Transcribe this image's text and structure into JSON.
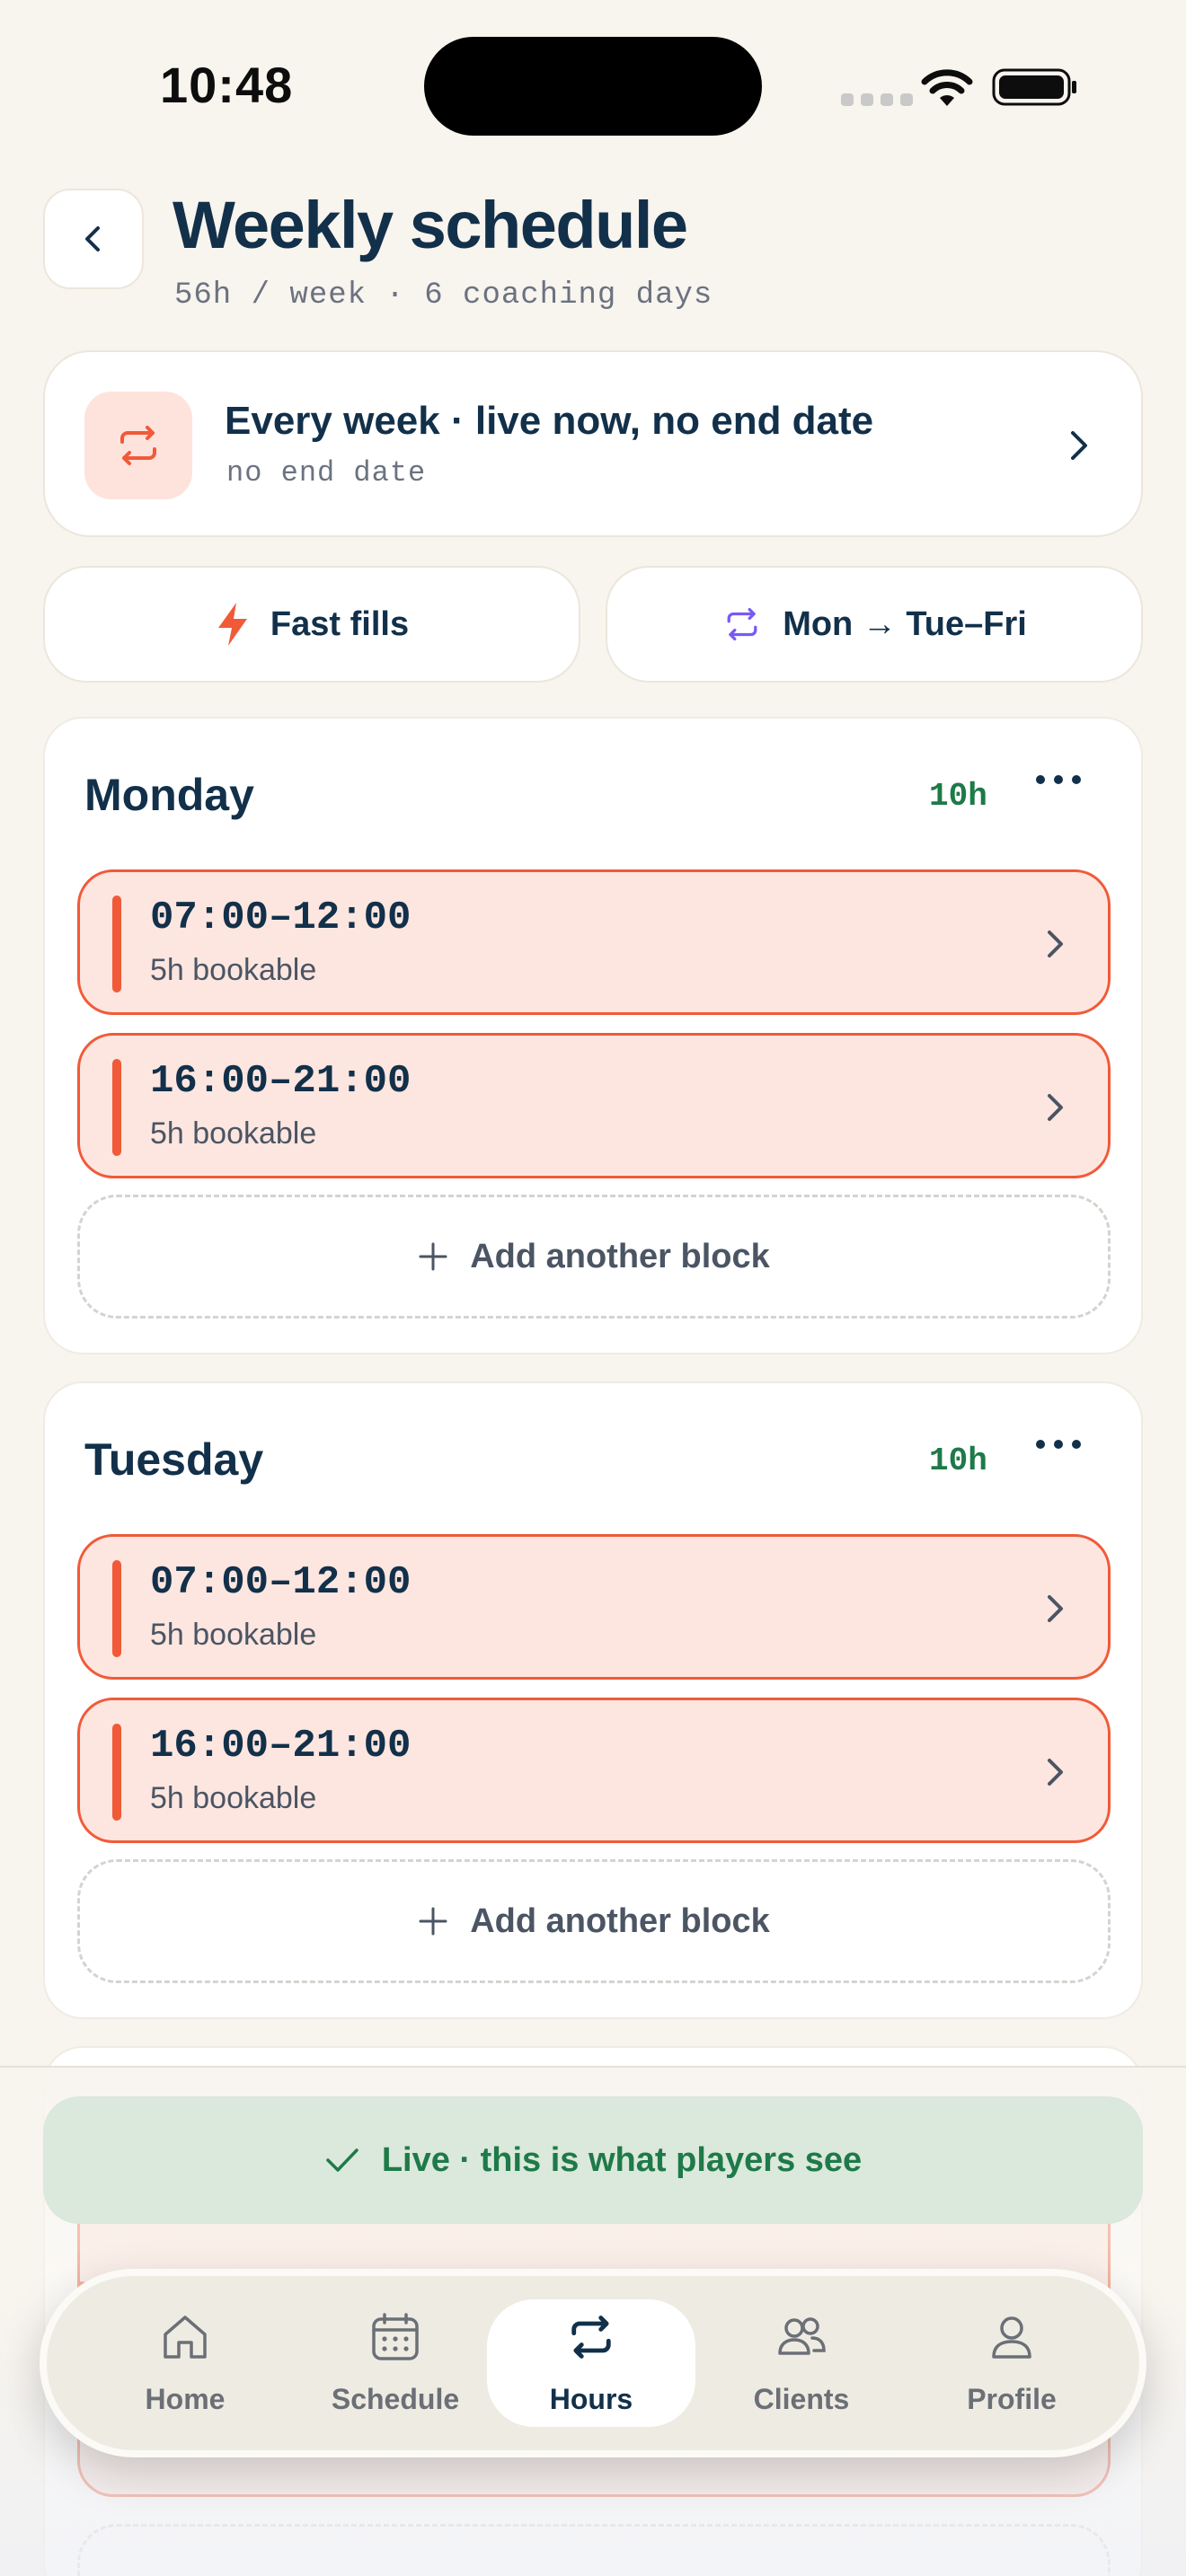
{
  "status_bar": {
    "time": "10:48"
  },
  "header": {
    "title": "Weekly schedule",
    "subtitle": "56h / week · 6 coaching days"
  },
  "recurrence": {
    "title": "Every week · live now, no end date",
    "subtitle": "no end date"
  },
  "quick_actions": {
    "fast_fills": "Fast fills",
    "copy_days": "Mon → Tue–Fri"
  },
  "days": [
    {
      "name": "Monday",
      "hours": "10h",
      "blocks": [
        {
          "time": "07:00–12:00",
          "sub": "5h bookable"
        },
        {
          "time": "16:00–21:00",
          "sub": "5h bookable"
        }
      ],
      "add_label": "Add another block"
    },
    {
      "name": "Tuesday",
      "hours": "10h",
      "blocks": [
        {
          "time": "07:00–12:00",
          "sub": "5h bookable"
        },
        {
          "time": "16:00–21:00",
          "sub": "5h bookable"
        }
      ],
      "add_label": "Add another block"
    }
  ],
  "live_banner": {
    "text": "Live · this is what players see"
  },
  "tab_bar": {
    "active": "Hours",
    "items": [
      {
        "label": "Home",
        "icon": "home-icon"
      },
      {
        "label": "Schedule",
        "icon": "calendar-icon"
      },
      {
        "label": "Hours",
        "icon": "repeat-icon"
      },
      {
        "label": "Clients",
        "icon": "users-icon"
      },
      {
        "label": "Profile",
        "icon": "user-icon"
      }
    ]
  },
  "colors": {
    "background": "#f8f4ee",
    "navy": "#12304a",
    "accent": "#f15a38",
    "block_fill": "#fde6e0",
    "green": "#1e7a48",
    "purple": "#7a5af5"
  }
}
